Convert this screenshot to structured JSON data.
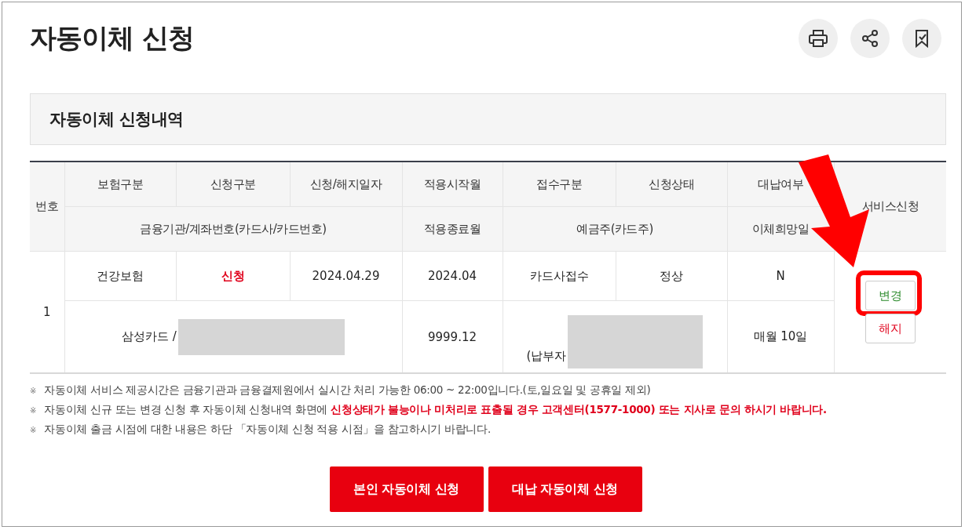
{
  "page": {
    "title": "자동이체 신청",
    "actions": [
      {
        "kind": "print"
      },
      {
        "kind": "share"
      },
      {
        "kind": "bookmark"
      }
    ]
  },
  "section": {
    "title": "자동이체 신청내역"
  },
  "table": {
    "number_header": "번호",
    "service_header": "서비스신청",
    "header_row_1": [
      "보험구분",
      "신청구분",
      "신청/해지일자",
      "적용시작월",
      "접수구분",
      "신청상태",
      "대납여부"
    ],
    "header_row_2": [
      "금융기관/계좌번호(카드사/카드번호)",
      "적용종료월",
      "예금주(카드주)",
      "이체희망일"
    ],
    "rows": [
      {
        "number": "1",
        "line_1": [
          {
            "text": "건강보험",
            "emphasis": false
          },
          {
            "text": "신청",
            "emphasis": true
          },
          {
            "text": "2024.04.29",
            "emphasis": false
          },
          {
            "text": "2024.04",
            "emphasis": false
          },
          {
            "text": "카드사접수",
            "emphasis": false
          },
          {
            "text": "정상",
            "emphasis": false
          },
          {
            "text": "N",
            "emphasis": false
          }
        ],
        "line_2": [
          {
            "text": "삼성카드 /",
            "redacted": true
          },
          {
            "text": "9999.12",
            "redacted": false
          },
          {
            "text": "(납부자",
            "redacted": true
          },
          {
            "text": "매월 10일",
            "redacted": false
          }
        ],
        "buttons": [
          {
            "label": "변경",
            "kind": "change",
            "callout": true
          },
          {
            "label": "해지",
            "kind": "cancel",
            "callout": false
          }
        ]
      }
    ]
  },
  "notes": [
    {
      "mark": "※",
      "text": "자동이체 서비스 제공시간은 금융기관과 금융결제원에서 실시간 처리 가능한 06:00 ~ 22:00입니다.(토,일요일 및 공휴일 제외)"
    },
    {
      "mark": "※",
      "text": "자동이체 신규 또는 변경 신청 후 자동이체 신청내역 화면에 ",
      "highlight": "신청상태가 불능이나 미처리로 표출될 경우 고객센터(1577-1000) 또는 지사로 문의 하시기 바랍니다."
    },
    {
      "mark": "※",
      "text": "자동이체 출금 시점에 대한 내용은 하단 「자동이체 신청 적용 시점」을 참고하시기 바랍니다."
    }
  ],
  "buttons": [
    "본인 자동이체 신청",
    "대납 자동이체 신청"
  ]
}
